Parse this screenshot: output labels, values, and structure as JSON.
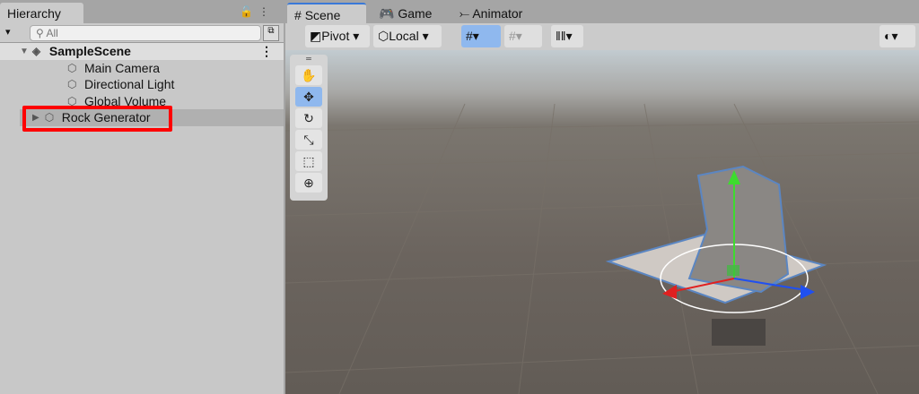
{
  "hierarchy": {
    "tab": "Hierarchy",
    "search_placeholder": "All",
    "scene": "SampleScene",
    "items": [
      "Main Camera",
      "Directional Light",
      "Global Volume",
      "Rock Generator"
    ]
  },
  "scene_tabs": [
    "Scene",
    "Game",
    "Animator"
  ],
  "toolbar": {
    "pivot": "Pivot",
    "local": "Local"
  },
  "colors": {
    "highlight": "#ff0000",
    "accent": "#3a79d8"
  }
}
